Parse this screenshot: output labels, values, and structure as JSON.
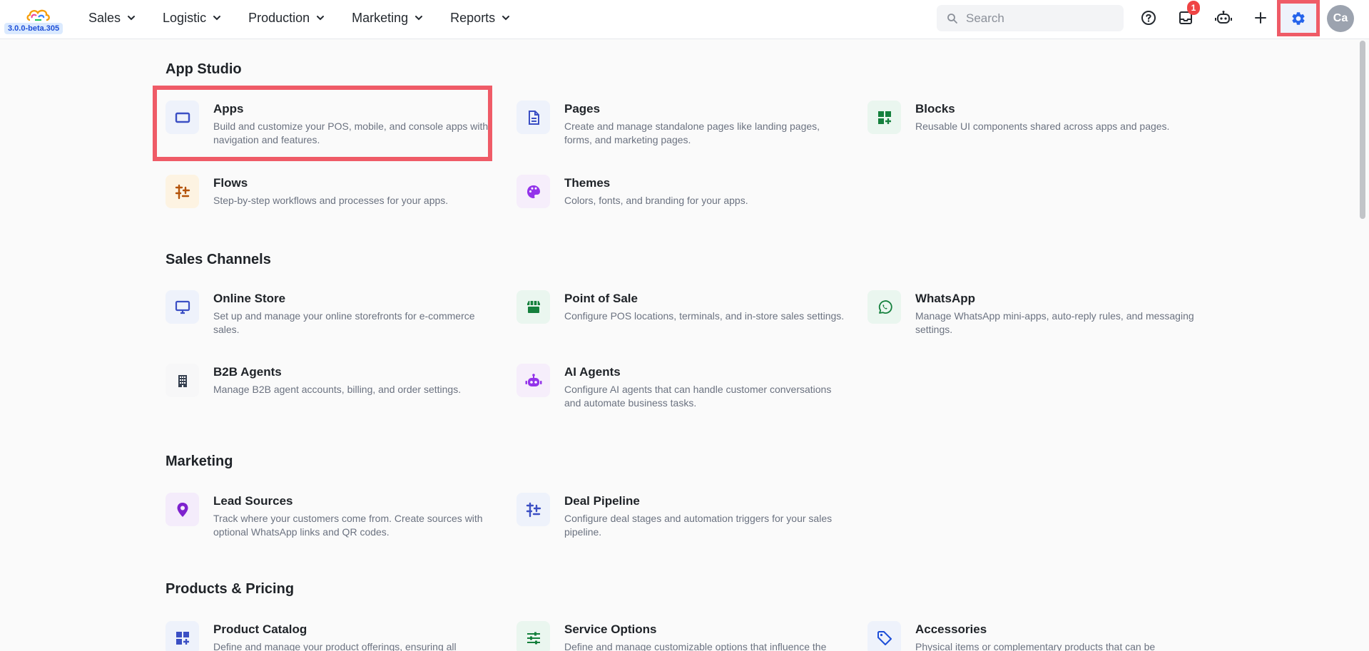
{
  "brand": {
    "version": "3.0.0-beta.305"
  },
  "nav": {
    "items": [
      {
        "label": "Sales"
      },
      {
        "label": "Logistic"
      },
      {
        "label": "Production"
      },
      {
        "label": "Marketing"
      },
      {
        "label": "Reports"
      }
    ]
  },
  "toolbar": {
    "search_placeholder": "Search",
    "notifications_count": "1",
    "avatar_initials": "Ca",
    "icons": [
      "help-icon",
      "inbox-icon",
      "bot-icon",
      "plus-icon",
      "settings-icon"
    ]
  },
  "sections": [
    {
      "title": "App Studio",
      "cards": [
        {
          "title": "Apps",
          "desc": "Build and customize your POS, mobile, and console apps with navigation and features.",
          "icon": "app-window-icon"
        },
        {
          "title": "Pages",
          "desc": "Create and manage standalone pages like landing pages, forms, and marketing pages.",
          "icon": "page-document-icon"
        },
        {
          "title": "Blocks",
          "desc": "Reusable UI components shared across apps and pages.",
          "icon": "blocks-grid-icon"
        },
        {
          "title": "Flows",
          "desc": "Step-by-step workflows and processes for your apps.",
          "icon": "flow-steps-icon"
        },
        {
          "title": "Themes",
          "desc": "Colors, fonts, and branding for your apps.",
          "icon": "palette-icon"
        }
      ]
    },
    {
      "title": "Sales Channels",
      "cards": [
        {
          "title": "Online Store",
          "desc": "Set up and manage your online storefronts for e-commerce sales.",
          "icon": "monitor-icon"
        },
        {
          "title": "Point of Sale",
          "desc": "Configure POS locations, terminals, and in-store sales settings.",
          "icon": "storefront-icon"
        },
        {
          "title": "WhatsApp",
          "desc": "Manage WhatsApp mini-apps, auto-reply rules, and messaging settings.",
          "icon": "whatsapp-icon"
        },
        {
          "title": "B2B Agents",
          "desc": "Manage B2B agent accounts, billing, and order settings.",
          "icon": "building-icon"
        },
        {
          "title": "AI Agents",
          "desc": "Configure AI agents that can handle customer conversations and automate business tasks.",
          "icon": "robot-icon"
        }
      ]
    },
    {
      "title": "Marketing",
      "cards": [
        {
          "title": "Lead Sources",
          "desc": "Track where your customers come from. Create sources with optional WhatsApp links and QR codes.",
          "icon": "location-pin-icon"
        },
        {
          "title": "Deal Pipeline",
          "desc": "Configure deal stages and automation triggers for your sales pipeline.",
          "icon": "pipeline-icon"
        }
      ]
    },
    {
      "title": "Products & Pricing",
      "cards": [
        {
          "title": "Product Catalog",
          "desc": "Define and manage your product offerings, ensuring all",
          "icon": "catalog-grid-icon"
        },
        {
          "title": "Service Options",
          "desc": "Define and manage customizable options that influence the",
          "icon": "sliders-icon"
        },
        {
          "title": "Accessories",
          "desc": "Physical items or complementary products that can be",
          "icon": "tag-icon"
        }
      ]
    }
  ],
  "colors": {
    "accent_blue": "#2563eb",
    "highlight_red": "#ef5b67",
    "badge_red": "#ef4444"
  }
}
